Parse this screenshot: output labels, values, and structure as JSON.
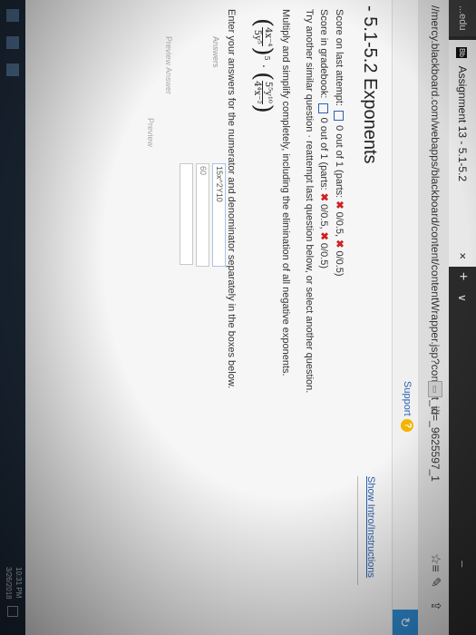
{
  "browser": {
    "prev_tab_label": "...edu",
    "active_tab_label": "Assignment 13 - 5.1-5.2",
    "tab_close": "×",
    "new_tab": "+",
    "tab_list": "∨",
    "minimize": "–",
    "url": "//mercy.blackboard.com/webapps/blackboard/content/contentWrapper.jsp?content_id=_9625597_1",
    "icons": [
      "reading-view-icon",
      "star-icon",
      "favorites-icon",
      "pen-icon",
      "share-icon"
    ]
  },
  "page": {
    "support_link": "Support",
    "help_badge": "?",
    "title": "- 5.1-5.2 Exponents",
    "show_intro": "Show Intro/Instructions",
    "score_prefix": "Score on last attempt:",
    "score_mid": "0 out of 1 (parts:",
    "score_rest": "0/0.5,",
    "score_end": "0/0.5)",
    "grade_prefix": "Score in gradebook:",
    "grade_mid": "0 out of 1 (parts:",
    "grade_rest": "0/0.5,",
    "grade_end": "0/0.5)",
    "another": "Try another similar question · reattempt last question below, or select another question.",
    "instructions": "Multiply and simplify completely, including the elimination of all negative exponents.",
    "expr": {
      "num1": "4x⁻⁴",
      "den1": "5y⁵",
      "exp1": "5",
      "num2": "5⁵y¹⁰",
      "den2": "4⁴x⁻²"
    },
    "enter_instructions": "Enter your answers for the numerator and denominator separately in the boxes below.",
    "answers_label": "Answers",
    "answer1": "15x^2Y10",
    "answer2": "60",
    "preview_answers": "Preview Answer",
    "preview": "Preview"
  },
  "taskbar": {
    "time": "10:31 PM",
    "date": "3/26/2018"
  },
  "colors": {
    "link": "#2b63b0",
    "error_x": "#cc2222",
    "help_badge": "#f4b400"
  }
}
